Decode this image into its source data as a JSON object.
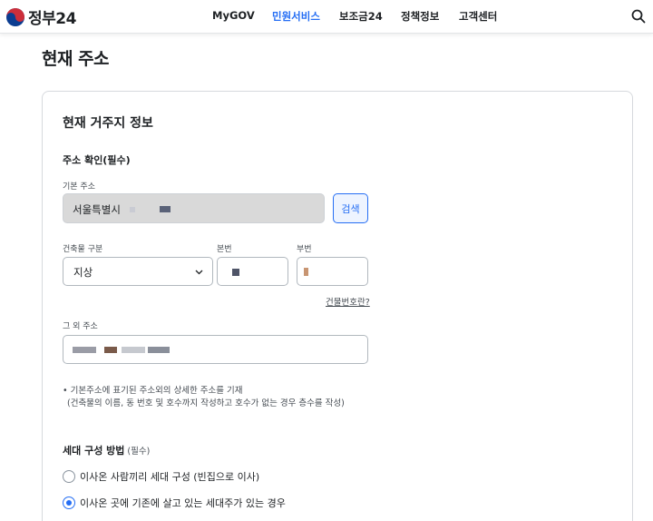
{
  "header": {
    "logo_text": "정부24",
    "nav": [
      "MyGOV",
      "민원서비스",
      "보조금24",
      "정책정보",
      "고객센터"
    ],
    "active_nav": "민원서비스",
    "search_icon": "search-icon"
  },
  "page": {
    "title": "현재 주소"
  },
  "form": {
    "section_title": "현재 거주지 정보",
    "address_confirm_title": "주소 확인(필수)",
    "base_address_label": "기본 주소",
    "base_address_value": "서울특별시",
    "search_button": "검색",
    "building_type_label": "건축물 구분",
    "building_type_value": "지상",
    "main_number_label": "본번",
    "sub_number_label": "부번",
    "building_number_link": "건물번호란?",
    "other_address_label": "그 외 주소",
    "note_line1": "• 기본주소에 표기된 주소외의 상세한 주소를 기재",
    "note_line2": "(건축물의 이름, 동 번호 및 호수까지 작성하고 호수가 없는 경우 층수를 작성)",
    "household_title": "세대 구성 방법",
    "household_required": "(필수)",
    "household_options": [
      "이사온 사람끼리 세대 구성 (빈집으로 이사)",
      "이사온 곳에 기존에 살고 있는 세대주가 있는 경우"
    ],
    "household_selected": 1
  },
  "colors": {
    "accent": "#256ef4",
    "text": "#1e2124",
    "border": "#b1b8be",
    "disabled_bg": "#d9d9d9"
  }
}
